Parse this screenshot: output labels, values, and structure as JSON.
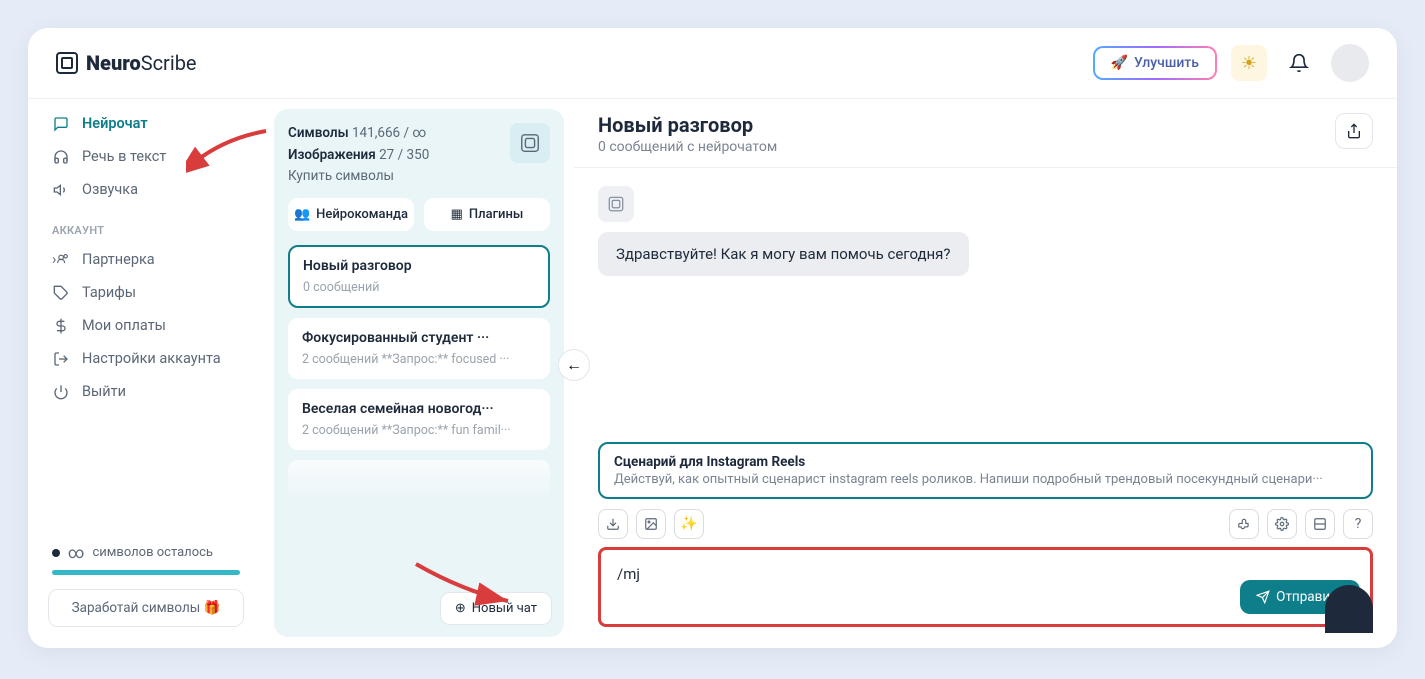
{
  "header": {
    "logo_bold": "Neuro",
    "logo_light": "Scribe",
    "improve_label": "Улучшить"
  },
  "sidebar": {
    "items": [
      {
        "icon": "chat-icon",
        "label": "Нейрочат",
        "active": true
      },
      {
        "icon": "headphones-icon",
        "label": "Речь в текст",
        "active": false
      },
      {
        "icon": "speaker-icon",
        "label": "Озвучка",
        "active": false
      }
    ],
    "section_title": "АККАУНТ",
    "account": [
      {
        "icon": "users-icon",
        "label": "Партнерка"
      },
      {
        "icon": "tag-icon",
        "label": "Тарифы"
      },
      {
        "icon": "dollar-icon",
        "label": "Мои оплаты"
      },
      {
        "icon": "logout-icon",
        "label": "Настройки аккаунта"
      },
      {
        "icon": "power-icon",
        "label": "Выйти"
      }
    ],
    "symbols_left": "символов осталось",
    "earn_label": "Заработай символы 🎁"
  },
  "chatlist": {
    "symbols_label": "Символы",
    "symbols_value": "141,666 / ∞",
    "images_label": "Изображения",
    "images_value": "27 / 350",
    "buy_label": "Купить символы",
    "tab1": "Нейрокоманда",
    "tab2": "Плагины",
    "chats": [
      {
        "title": "Новый разговор",
        "sub": "0 сообщений",
        "active": true
      },
      {
        "title": "Фокусированный студент ···",
        "sub": "2 сообщений   **Запрос:** focused ···",
        "active": false
      },
      {
        "title": "Веселая семейная новогод···",
        "sub": "2 сообщений   **Запрос:** fun famil···",
        "active": false
      }
    ],
    "new_chat": "Новый чат"
  },
  "chat": {
    "title": "Новый разговор",
    "subtitle": "0 сообщений с нейрочатом",
    "greeting": "Здравствуйте! Как я могу вам помочь сегодня?",
    "prompt_title": "Сценарий для Instagram Reels",
    "prompt_desc": "Действуй, как опытный сценарист instagram reels роликов. Напиши подробный трендовый посекундный сценари···",
    "input_value": "/mj",
    "send_label": "Отправить"
  }
}
